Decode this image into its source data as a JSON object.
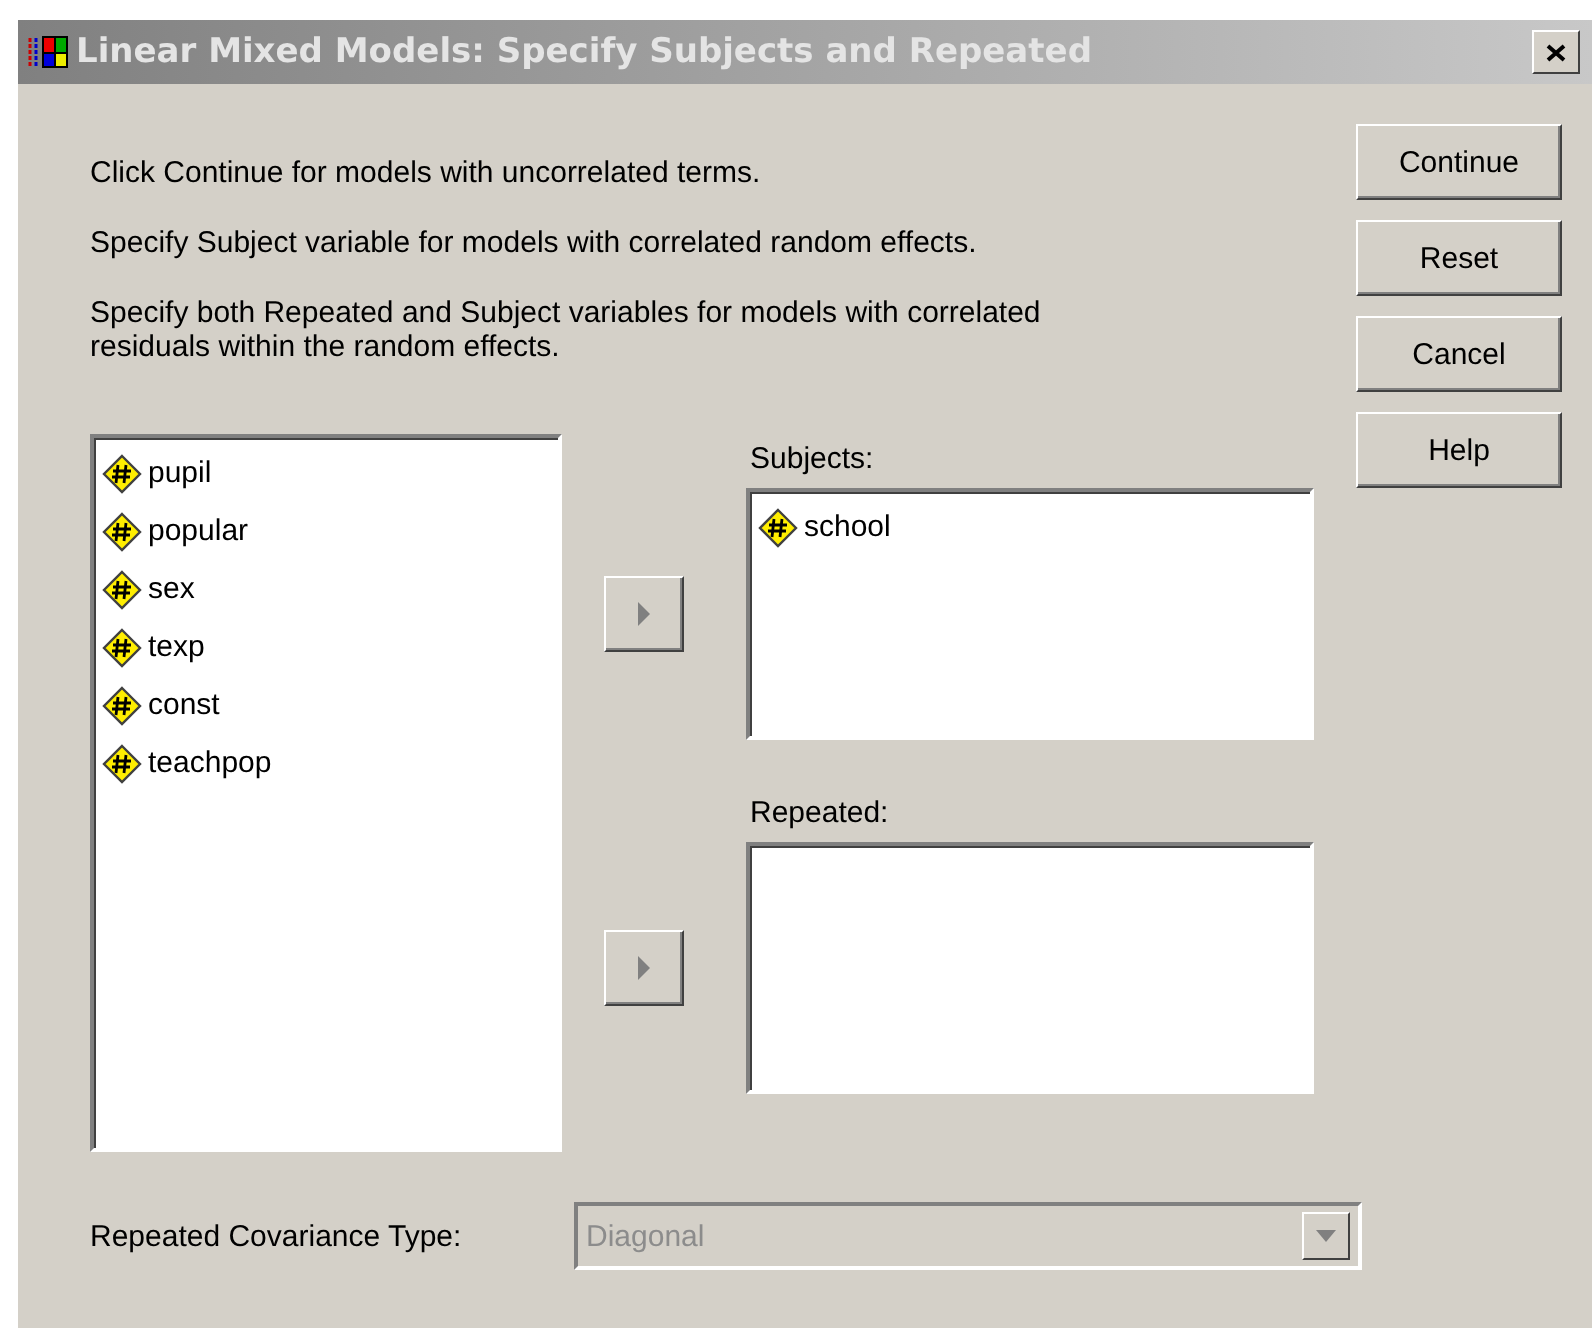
{
  "window": {
    "title": "Linear Mixed Models: Specify Subjects and Repeated",
    "active": false
  },
  "instructions": [
    "Click Continue for models with uncorrelated terms.",
    "Specify Subject variable for models with correlated random effects.",
    "Specify both Repeated and Subject variables for models with correlated residuals within the random effects."
  ],
  "variables": [
    "pupil",
    "popular",
    "sex",
    "texp",
    "const",
    "teachpop"
  ],
  "subjects": {
    "label": "Subjects:",
    "items": [
      "school"
    ],
    "move_button": {
      "disabled": true
    }
  },
  "repeated": {
    "label": "Repeated:",
    "move_button": {
      "disabled": true
    }
  },
  "buttons": [
    {
      "label": "Continue"
    },
    {
      "label": "Reset"
    },
    {
      "label": "Cancel"
    },
    {
      "label": "Help"
    }
  ],
  "covariance_type": {
    "label": "Repeated Covariance Type:",
    "value": "Diagonal",
    "disabled": true
  }
}
